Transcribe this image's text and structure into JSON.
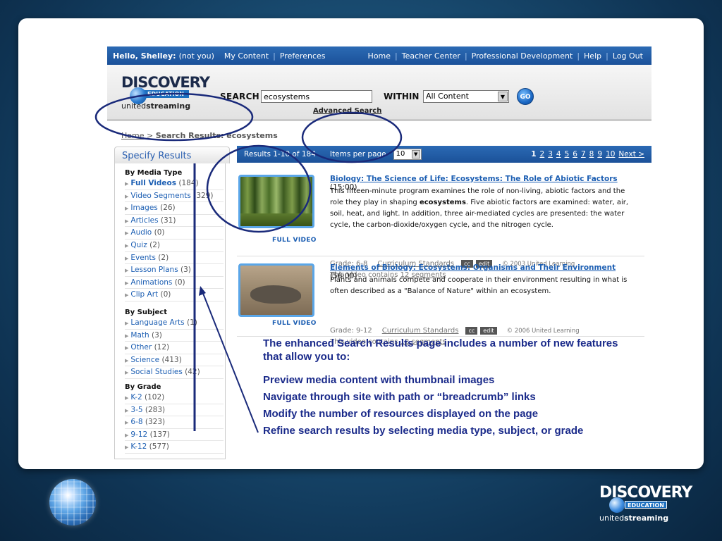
{
  "topbar": {
    "hello": "Hello, Shelley:",
    "not_you": "(not you)",
    "left_links": [
      "My Content",
      "Preferences"
    ],
    "right_links": [
      "Home",
      "Teacher Center",
      "Professional Development",
      "Help",
      "Log Out"
    ]
  },
  "header": {
    "logo_brand": "DISCOVERY",
    "logo_sub": "EDUCATION",
    "logo_united": "united",
    "logo_streaming": "streaming",
    "search_label": "SEARCH",
    "search_value": "ecosystems",
    "within_label": "WITHIN",
    "within_value": "All Content",
    "go_label": "GO",
    "advanced_search": "Advanced Search"
  },
  "breadcrumb": {
    "home": "Home",
    "separator": ">",
    "current": "Search Results: ecosystems"
  },
  "sidebar": {
    "title": "Specify Results",
    "groups": [
      {
        "heading": "By Media Type",
        "items": [
          {
            "label": "Full Videos",
            "count": "(184)"
          },
          {
            "label": "Video Segments",
            "count": "(329)"
          },
          {
            "label": "Images",
            "count": "(26)"
          },
          {
            "label": "Articles",
            "count": "(31)"
          },
          {
            "label": "Audio",
            "count": "(0)"
          },
          {
            "label": "Quiz",
            "count": "(2)"
          },
          {
            "label": "Events",
            "count": "(2)"
          },
          {
            "label": "Lesson Plans",
            "count": "(3)"
          },
          {
            "label": "Animations",
            "count": "(0)"
          },
          {
            "label": "Clip Art",
            "count": "(0)"
          }
        ]
      },
      {
        "heading": "By Subject",
        "items": [
          {
            "label": "Language Arts",
            "count": "(1)"
          },
          {
            "label": "Math",
            "count": "(3)"
          },
          {
            "label": "Other",
            "count": "(12)"
          },
          {
            "label": "Science",
            "count": "(413)"
          },
          {
            "label": "Social Studies",
            "count": "(42)"
          }
        ]
      },
      {
        "heading": "By Grade",
        "items": [
          {
            "label": "K-2",
            "count": "(102)"
          },
          {
            "label": "3-5",
            "count": "(283)"
          },
          {
            "label": "6-8",
            "count": "(323)"
          },
          {
            "label": "9-12",
            "count": "(137)"
          },
          {
            "label": "K-12",
            "count": "(577)"
          }
        ]
      }
    ]
  },
  "results_bar": {
    "summary": "Results 1-10 of 184",
    "items_per_page_label": "Items per page",
    "items_per_page_value": "10",
    "pages": [
      "1",
      "2",
      "3",
      "4",
      "5",
      "6",
      "7",
      "8",
      "9",
      "10"
    ],
    "current_page": "1",
    "next": "Next >"
  },
  "results": [
    {
      "title": "Biology: The Science of Life: Ecosystems: The Role of Abiotic Factors",
      "duration": "(15:00)",
      "desc_before": "This fifteen-minute program examines the role of non-living, abiotic factors and the role they play in shaping ",
      "desc_bold": "ecosystems",
      "desc_after": ". Five abiotic factors are examined: water, air, soil, heat, and light. In addition, three air-mediated cycles are presented: the water cycle, the carbon-dioxide/oxygen cycle, and the nitrogen cycle.",
      "grade": "Grade: 6-8",
      "standards": "Curriculum Standards",
      "tag_cc": "cc",
      "tag_edit": "edit",
      "copyright": "© 2003 United Learning",
      "segments_prefix": "This video contains ",
      "segments_link": "12 segments",
      "badge": "FULL VIDEO"
    },
    {
      "title": "Elements of Biology: Ecosystems: Organisms and Their Environment",
      "duration": "(56:00)",
      "desc_before": "Plants and animals compete and cooperate in their environment resulting in what is often described as a \"Balance of Nature\" within an ecosystem.",
      "desc_bold": "",
      "desc_after": "",
      "grade": "Grade: 9-12",
      "standards": "Curriculum Standards",
      "tag_cc": "cc",
      "tag_edit": "edit",
      "copyright": "© 2006 United Learning",
      "segments_prefix": "This video contains ",
      "segments_link": "12 segments",
      "badge": "FULL VIDEO"
    }
  ],
  "note": {
    "intro": "The enhanced Search Results page includes a number of new features that allow you to:",
    "features": [
      "Preview media content with thumbnail images",
      "Navigate through site with path or “breadcrumb” links",
      "Modify the number of resources displayed on the page",
      "Refine search results by selecting media type, subject, or grade"
    ]
  },
  "footer_logo": {
    "brand": "DISCOVERY",
    "sub": "EDUCATION",
    "united": "united",
    "streaming": "streaming"
  },
  "colors": {
    "accent_blue": "#1b5199",
    "link_blue": "#1d5fb3",
    "annotation_navy": "#1a2a8a",
    "slide_background": "#1a4e74"
  }
}
